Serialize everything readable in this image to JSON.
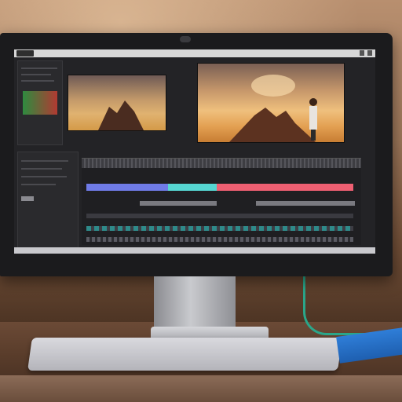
{
  "scene": {
    "description_visible_text": "",
    "colors": {
      "wall": "#9c7659",
      "desk": "#5a3d2b",
      "monitor_bezel": "#1b1b1d",
      "accent_cable": "#2aa68a",
      "notebook": "#2f7ed8"
    }
  },
  "editor": {
    "program_monitor_visible": true,
    "source_monitor_visible": true,
    "timeline_clip_colors": [
      "#6f7be7",
      "#56d6d2",
      "#ee5f72"
    ]
  }
}
